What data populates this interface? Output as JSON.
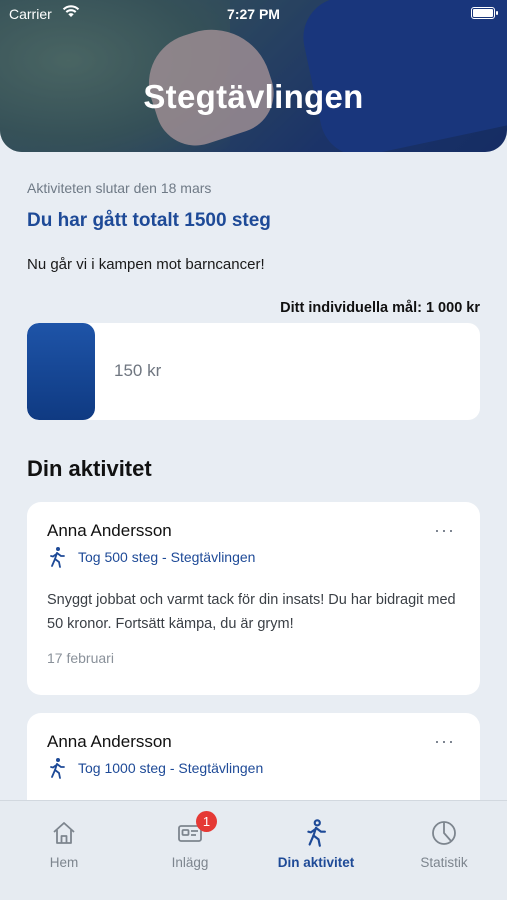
{
  "status_bar": {
    "carrier": "Carrier",
    "time": "7:27 PM"
  },
  "header": {
    "title": "Stegtävlingen"
  },
  "info": {
    "ends_text": "Aktiviteten slutar den 18 mars",
    "total_text": "Du har gått totalt 1500 steg",
    "intro_text": "Nu går vi i kampen mot barncancer!"
  },
  "goal": {
    "label": "Ditt individuella mål:",
    "value": "1 000 kr",
    "raised": "150 kr",
    "progress_fraction": 0.15
  },
  "activity": {
    "title": "Din aktivitet",
    "items": [
      {
        "name": "Anna Andersson",
        "tag": "Tog 500 steg - Stegtävlingen",
        "message": "Snyggt jobbat och varmt tack för din insats! Du har bidragit med 50 kronor. Fortsätt kämpa, du är grym!",
        "date": "17 februari",
        "more": "···"
      },
      {
        "name": "Anna Andersson",
        "tag": "Tog 1000 steg - Stegtävlingen",
        "more": "···"
      }
    ]
  },
  "tabbar": {
    "items": [
      {
        "label": "Hem",
        "icon": "house-icon"
      },
      {
        "label": "Inlägg",
        "icon": "id-card-icon",
        "badge": "1"
      },
      {
        "label": "Din aktivitet",
        "icon": "walking-person-icon",
        "active": true
      },
      {
        "label": "Statistik",
        "icon": "pie-chart-icon"
      }
    ]
  },
  "colors": {
    "accent": "#1e4a97",
    "badge": "#e53935",
    "background": "#e8edf3"
  }
}
